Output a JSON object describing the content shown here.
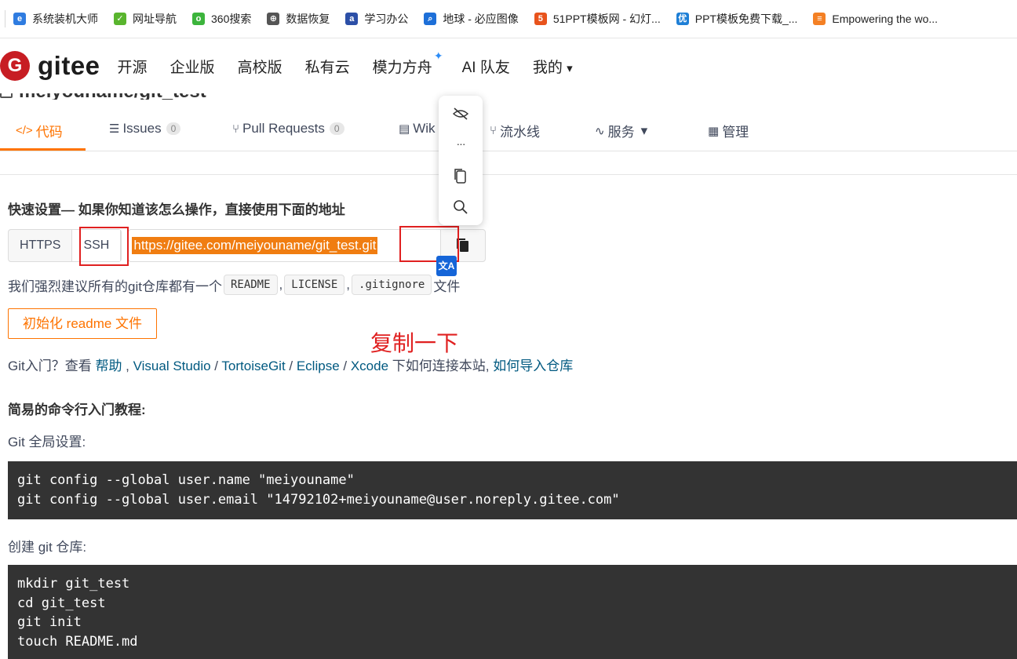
{
  "bookmarks": [
    {
      "label": "系统装机大师",
      "icon": "globe-blue-icon",
      "color": "#2f7ce0",
      "glyph": "e"
    },
    {
      "label": "网址导航",
      "icon": "hao-icon",
      "color": "#59b52e",
      "glyph": "✓"
    },
    {
      "label": "360搜索",
      "icon": "360-icon",
      "color": "#3cb43c",
      "glyph": "o"
    },
    {
      "label": "数据恢复",
      "icon": "globe-icon",
      "color": "#555555",
      "glyph": "⊕"
    },
    {
      "label": "学习办公",
      "icon": "ai-icon",
      "color": "#2c4fa7",
      "glyph": "a"
    },
    {
      "label": "地球 - 必应图像",
      "icon": "search-icon",
      "color": "#1d6fd8",
      "glyph": "⌕"
    },
    {
      "label": "51PPT模板网 - 幻灯...",
      "icon": "51ppt-icon",
      "color": "#e8531c",
      "glyph": "5"
    },
    {
      "label": "PPT模板免费下载_...",
      "icon": "you-icon",
      "color": "#1e7fd6",
      "glyph": "优"
    },
    {
      "label": "Empowering the wo...",
      "icon": "stack-icon",
      "color": "#f48024",
      "glyph": "≡"
    }
  ],
  "header": {
    "brand": "gitee",
    "brand_mark": "G",
    "nav": [
      "开源",
      "企业版",
      "高校版",
      "私有云",
      "模力方舟",
      "AI 队友",
      "我的"
    ],
    "spark": "✦",
    "caret": "▾"
  },
  "repo": {
    "title": "meiyouname/git_test"
  },
  "tabs": {
    "code": "代码",
    "issues": "Issues",
    "issues_count": "0",
    "prs": "Pull Requests",
    "prs_count": "0",
    "wiki": "Wik",
    "pipeline": "流水线",
    "services": "服务",
    "manage": "管理"
  },
  "quick": {
    "title": "快速设置— 如果你知道该怎么操作，直接使用下面的地址",
    "https": "HTTPS",
    "ssh": "SSH",
    "url": "https://gitee.com/meiyouname/git_test.git",
    "recommend_prefix": "我们强烈建议所有的git仓库都有一个",
    "readme": "README",
    "license": "LICENSE",
    "gitignore": ".gitignore",
    "comma": ",",
    "recommend_suffix": "文件",
    "init_button": "初始化 readme 文件",
    "translate": "文A"
  },
  "annotation": "复制一下",
  "gitintro": {
    "prefix": "Git入门？查看 ",
    "help": "帮助",
    "sep1": " , ",
    "vs": "Visual Studio",
    "slash1": " / ",
    "tortoise": "TortoiseGit",
    "slash2": " / ",
    "eclipse": "Eclipse",
    "slash3": " / ",
    "xcode": "Xcode",
    "middle": " 下如何连接本站, ",
    "import": "如何导入仓库"
  },
  "tutorial": {
    "title": "简易的命令行入门教程:",
    "global_label": "Git 全局设置:",
    "global_code": "git config --global user.name \"meiyouname\"\ngit config --global user.email \"14792102+meiyouname@user.noreply.gitee.com\"",
    "create_label": "创建 git 仓库:",
    "create_code": "mkdir git_test\ncd git_test\ngit init\ntouch README.md"
  },
  "popup": {
    "hide_icon": "eye-off-icon",
    "more": "···",
    "copy_icon": "copy-icon",
    "search_icon": "search-icon"
  }
}
